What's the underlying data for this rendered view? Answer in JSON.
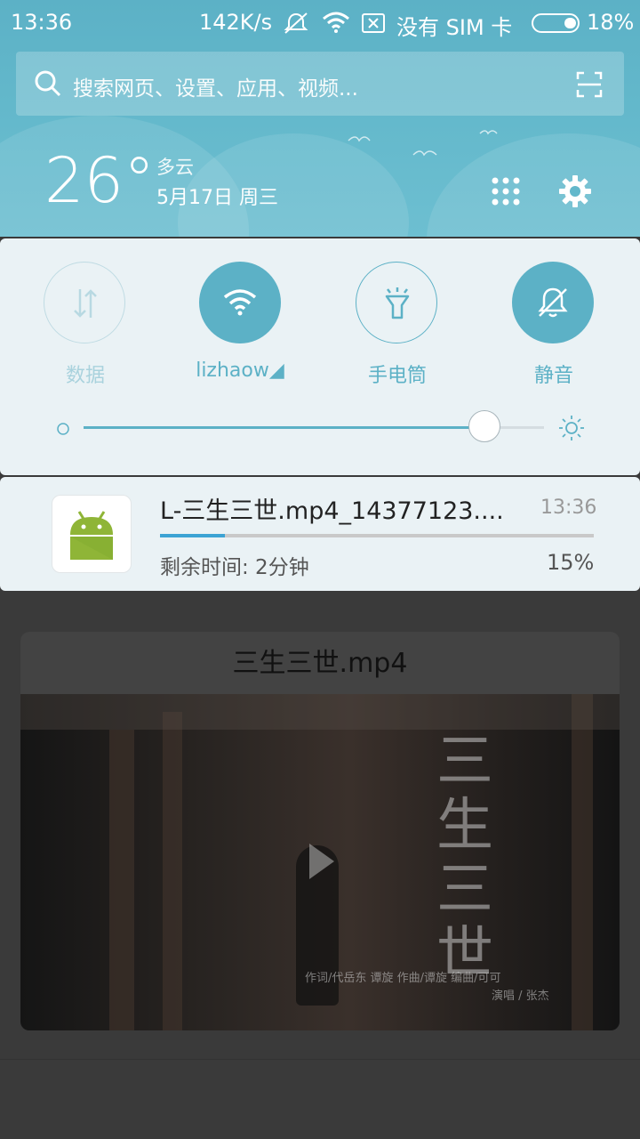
{
  "status_bar": {
    "time": "13:36",
    "speed": "142K/s",
    "carrier": "没有 SIM 卡",
    "battery": "18%"
  },
  "search": {
    "placeholder": "搜索网页、设置、应用、视频..."
  },
  "weather": {
    "temperature": "26°",
    "condition": "多云",
    "date": "5月17日 周三"
  },
  "quick_settings": [
    {
      "label": "数据",
      "icon": "data-toggle-icon",
      "active": false
    },
    {
      "label": "lizhaow◢",
      "icon": "wifi-icon",
      "active": true
    },
    {
      "label": "手电筒",
      "icon": "flashlight-icon",
      "active": false
    },
    {
      "label": "静音",
      "icon": "mute-bell-icon",
      "active": true
    }
  ],
  "brightness": {
    "level_fraction": 0.87
  },
  "notification": {
    "title": "L-三生三世.mp4_14377123....",
    "time": "13:36",
    "remaining": "剩余时间: 2分钟",
    "percent": "15%",
    "progress_fraction": 0.15
  },
  "card": {
    "title": "三生三世.mp4",
    "calligraphy": "三生三世",
    "credits_line1": "作词/代岳东 谭旋   作曲/谭旋   编曲/可可",
    "credits_line2": "演唱 / 张杰"
  },
  "colors": {
    "accent": "#5cb1c6",
    "header_bg": "#63b8cb",
    "panel_bg": "#eaf2f5",
    "progress": "#3ca3d4"
  }
}
